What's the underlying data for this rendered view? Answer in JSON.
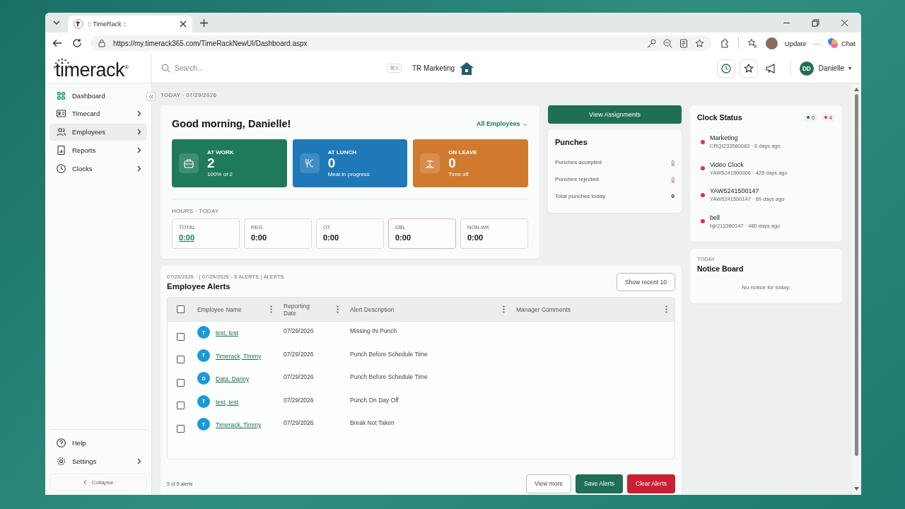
{
  "browser": {
    "tab_title": ":: TimeRack ::",
    "url": "https://my.timerack365.com/TimeRackNewUI/Dashboard.aspx",
    "update_label": "Update",
    "more_label": "···",
    "chat_label": "Chat"
  },
  "header": {
    "brand": "timerack$^{®}$",
    "search_placeholder": "Search...",
    "shortcut": "⌘S",
    "company": "TR Marketing",
    "user_initials": "DD",
    "user_name": "Danielle",
    "user_caret": "▾"
  },
  "sidebar": {
    "items": [
      {
        "label": "Dashboard",
        "selected": true,
        "highlighted": false,
        "submenu": false
      },
      {
        "label": "Timecard",
        "selected": false,
        "highlighted": false,
        "submenu": true
      },
      {
        "label": "Employees",
        "selected": false,
        "highlighted": true,
        "submenu": true
      },
      {
        "label": "Reports",
        "selected": false,
        "highlighted": false,
        "submenu": true
      },
      {
        "label": "Clocks",
        "selected": false,
        "highlighted": false,
        "submenu": true
      }
    ],
    "bottom_items": [
      {
        "label": "Help",
        "submenu": false
      },
      {
        "label": "Settings",
        "submenu": true
      }
    ],
    "collapse_label": "Collapse"
  },
  "date_line": "TODAY · 07/29/2026",
  "greeting": {
    "title": "Good morning, Danielle!",
    "link": "All Employees →",
    "stats": [
      {
        "label": "AT WORK",
        "value": "2",
        "note": "100% of 2",
        "color": "#1f7a5c"
      },
      {
        "label": "AT LUNCH",
        "value": "0",
        "note": "Meal in progress",
        "color": "#1f78b8"
      },
      {
        "label": "ON LEAVE",
        "value": "0",
        "note": "Time off",
        "color": "#d07a30"
      }
    ],
    "hours_label": "HOURS · TODAY",
    "hours": [
      {
        "label": "TOTAL",
        "value": "0:00",
        "kind": "link"
      },
      {
        "label": "REG",
        "value": "0:00",
        "kind": "plain"
      },
      {
        "label": "OT",
        "value": "0:00",
        "kind": "plain"
      },
      {
        "label": "DBL",
        "value": "0:00",
        "kind": "alert"
      },
      {
        "label": "NON-WK",
        "value": "0:00",
        "kind": "plain"
      }
    ]
  },
  "assignments_button": "View Assignments",
  "punches": {
    "title": "Punches",
    "rows": [
      {
        "label": "Punches accepted",
        "value": "0",
        "kind": "good"
      },
      {
        "label": "Punches rejected",
        "value": "0",
        "kind": "bad"
      },
      {
        "label": "Total punches today",
        "value": "0",
        "kind": "plain"
      }
    ]
  },
  "clock_status": {
    "title": "Clock Status",
    "counts": [
      {
        "value": "0",
        "color": "#1f6e50"
      },
      {
        "value": "4",
        "color": "#e0314f"
      }
    ],
    "clocks": [
      {
        "name": "Marketing",
        "detail": "CRQI233560083 · 6 days ago",
        "color": "#e0314f"
      },
      {
        "name": "Video Clock",
        "detail": "YAW5241500006 · 425 days ago",
        "color": "#e0314f"
      },
      {
        "name": "YAW5241500147",
        "detail": "YAW5241500147 · 69 days ago",
        "color": "#e0314f"
      },
      {
        "name": "bell",
        "detail": "bjir213360147 · 480 days ago",
        "color": "#e0314f"
      }
    ]
  },
  "notice_board": {
    "eyebrow": "TODAY",
    "title": "Notice Board",
    "empty": "No notice for today."
  },
  "alerts": {
    "subtitle": "07/29/2026 · ( 07/29/2026 - 5 ALERTS ) ALERTS",
    "title": "Employee Alerts",
    "recent_button": "Show recent 10",
    "select_all": false,
    "columns": [
      "Employee Name",
      "Reporting Date",
      "Alert Description",
      "Manager Comments"
    ],
    "rows": [
      {
        "checked": false,
        "initial": "T",
        "name": "test, test",
        "date": "07/29/2026",
        "description": "Missing IN Punch"
      },
      {
        "checked": false,
        "initial": "T",
        "name": "Timerack, Timmy",
        "date": "07/29/2026",
        "description": "Punch Before Schedule Time"
      },
      {
        "checked": false,
        "initial": "D",
        "name": "Data, Danny",
        "date": "07/29/2026",
        "description": "Punch Before Schedule Time"
      },
      {
        "checked": false,
        "initial": "T",
        "name": "test, test",
        "date": "07/29/2026",
        "description": "Punch On Day Off"
      },
      {
        "checked": false,
        "initial": "T",
        "name": "Timerack, Timmy",
        "date": "07/29/2026",
        "description": "Break Not Taken"
      }
    ],
    "count": "5 of 5 alerts",
    "buttons": [
      {
        "label": "View more",
        "kind": "outline"
      },
      {
        "label": "Save Alerts",
        "kind": "primary"
      },
      {
        "label": "Clear Alerts",
        "kind": "danger"
      }
    ]
  }
}
